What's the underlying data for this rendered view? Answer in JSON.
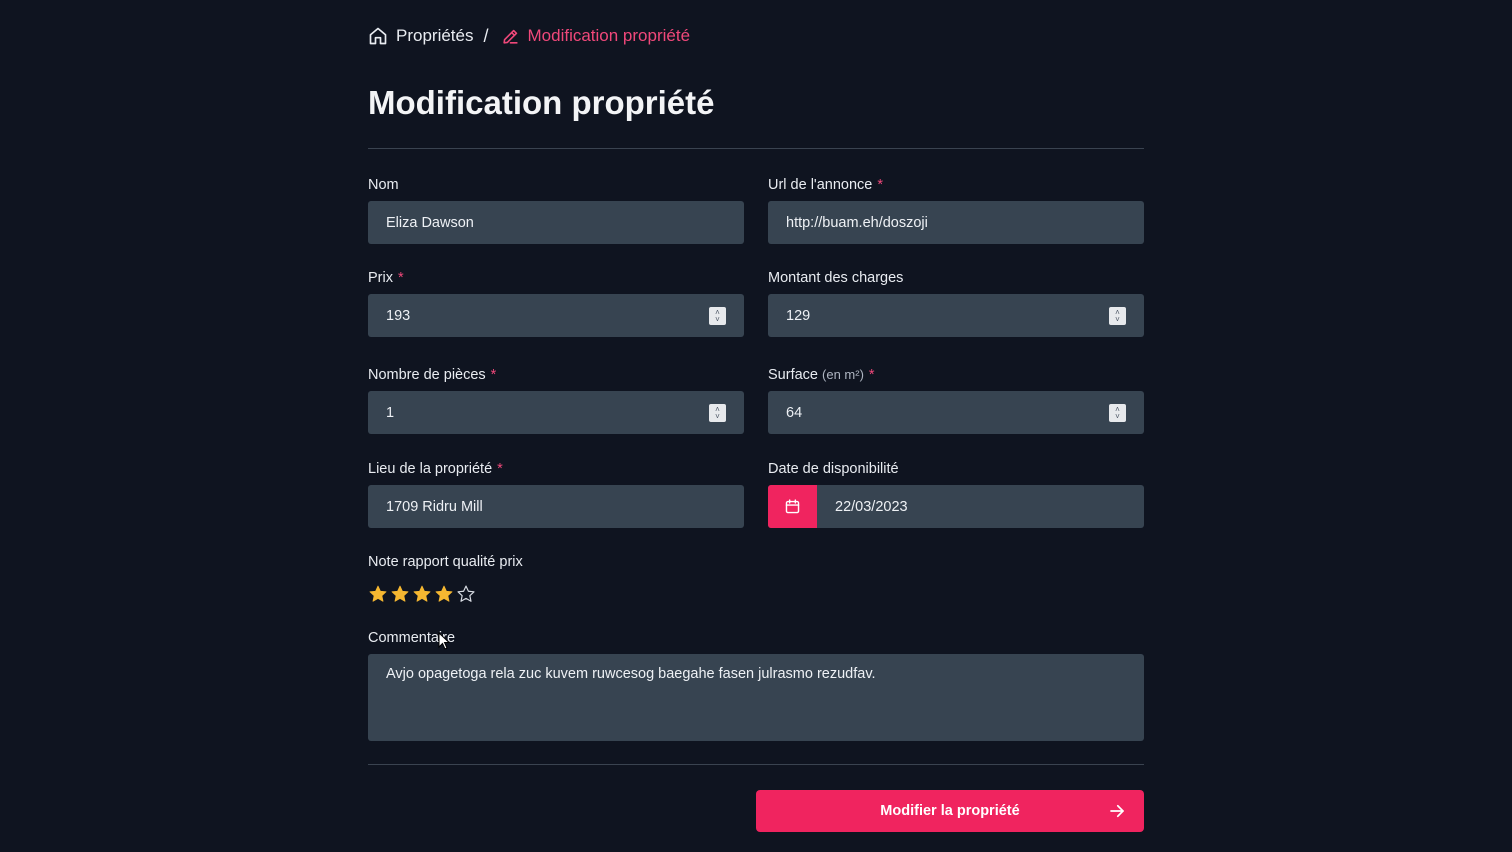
{
  "breadcrumb": {
    "home_label": "Propriétés",
    "separator": "/",
    "current_label": "Modification propriété",
    "home_icon": "home-icon",
    "current_icon": "pencil-icon"
  },
  "page_title": "Modification propriété",
  "form": {
    "nom": {
      "label": "Nom",
      "value": "Eliza Dawson"
    },
    "url": {
      "label": "Url de l'annonce",
      "required": "*",
      "value": "http://buam.eh/doszoji"
    },
    "prix": {
      "label": "Prix",
      "required": "*",
      "value": "193"
    },
    "charges": {
      "label": "Montant des charges",
      "value": "129"
    },
    "pieces": {
      "label": "Nombre de pièces",
      "required": "*",
      "value": "1"
    },
    "surface": {
      "label": "Surface",
      "unit": "(en m²)",
      "required": "*",
      "value": "64"
    },
    "lieu": {
      "label": "Lieu de la propriété",
      "required": "*",
      "value": "1709 Ridru Mill"
    },
    "date": {
      "label": "Date de disponibilité",
      "value": "22/03/2023",
      "icon": "calendar-icon"
    },
    "note": {
      "label": "Note rapport qualité prix",
      "rating": 4,
      "max": 5
    },
    "commentaire": {
      "label": "Commentaire",
      "value": "Avjo opagetoga rela zuc kuvem ruwcesog baegahe fasen julrasmo rezudfav."
    }
  },
  "submit_label": "Modifier la propriété",
  "colors": {
    "background": "#0f1420",
    "input": "#374451",
    "accent": "#f0245f",
    "accent_text": "#f0487a",
    "star": "#f5b731"
  }
}
